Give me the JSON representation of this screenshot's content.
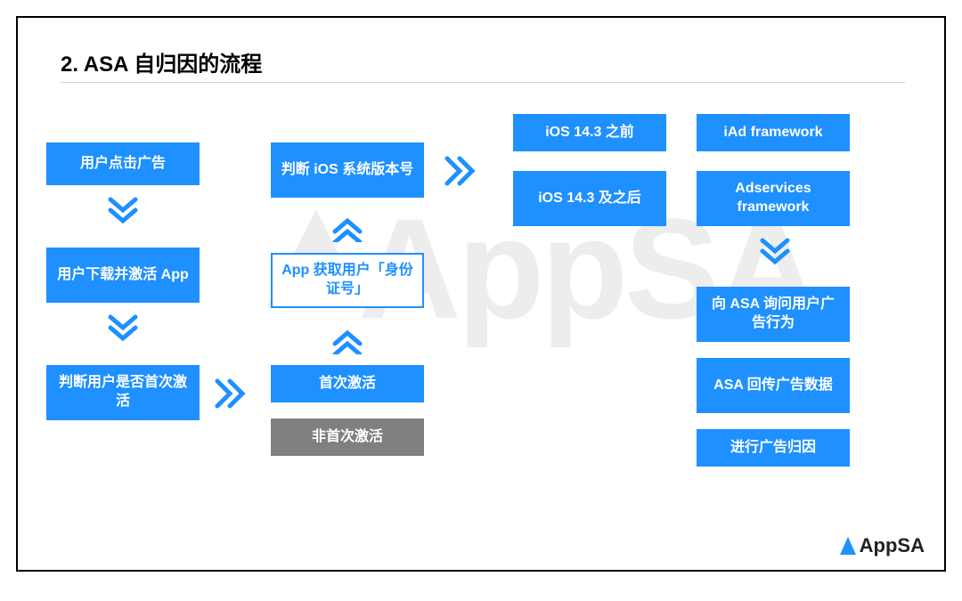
{
  "title": "2. ASA 自归因的流程",
  "col1": {
    "b1": "用户点击广告",
    "b2": "用户下载并激活 App",
    "b3": "判断用户是否首次激活"
  },
  "col2": {
    "b4": "判断 iOS 系统版本号",
    "b5": "App 获取用户「身份证号」",
    "b6": "首次激活",
    "b7": "非首次激活"
  },
  "row3": {
    "b8": "iOS 14.3 之前",
    "b9": "iAd framework",
    "b10": "iOS 14.3 及之后",
    "b11": "Adservices framework"
  },
  "col4": {
    "b12": "向 ASA 询问用户广告行为",
    "b13": "ASA 回传广告数据",
    "b14": "进行广告归因"
  },
  "watermark": "AppSA",
  "logo": "AppSA"
}
